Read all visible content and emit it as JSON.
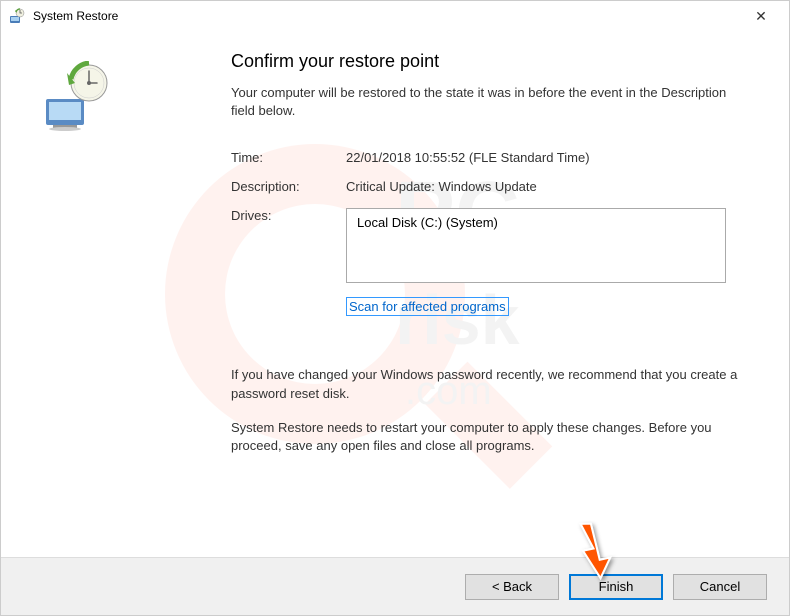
{
  "titlebar": {
    "title": "System Restore",
    "close": "✕"
  },
  "heading": "Confirm your restore point",
  "subtitle": "Your computer will be restored to the state it was in before the event in the Description field below.",
  "fields": {
    "time_label": "Time:",
    "time_value": "22/01/2018 10:55:52 (FLE Standard Time)",
    "description_label": "Description:",
    "description_value": "Critical Update: Windows Update",
    "drives_label": "Drives:",
    "drives_value": "Local Disk (C:) (System)"
  },
  "scan_link": "Scan for affected programs",
  "note_password": "If you have changed your Windows password recently, we recommend that you create a password reset disk.",
  "note_restart": "System Restore needs to restart your computer to apply these changes. Before you proceed, save any open files and close all programs.",
  "buttons": {
    "back": "< Back",
    "finish": "Finish",
    "cancel": "Cancel"
  }
}
